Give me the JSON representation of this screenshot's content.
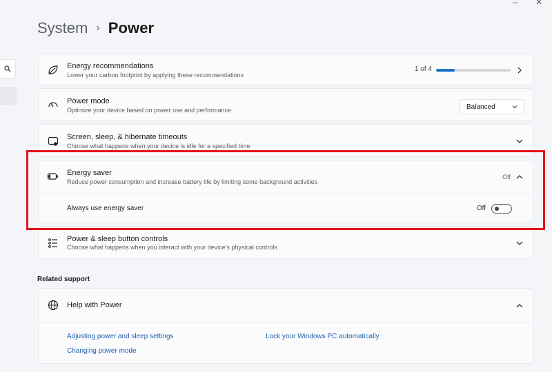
{
  "breadcrumb": {
    "parent": "System",
    "separator": "›",
    "current": "Power"
  },
  "settings": [
    {
      "title": "Energy recommendations",
      "subtitle": "Lower your carbon footprint by applying these recommendations",
      "progress_label": "1 of 4",
      "progress": 0.25
    },
    {
      "title": "Power mode",
      "subtitle": "Optimize your device based on power use and performance",
      "dropdown_value": "Balanced"
    },
    {
      "title": "Screen, sleep, & hibernate timeouts",
      "subtitle": "Choose what happens when your device is idle for a specified time"
    },
    {
      "title": "Energy saver",
      "subtitle": "Reduce power consumption and increase battery life by limiting some background activities",
      "status": "Off",
      "subsetting": {
        "label": "Always use energy saver",
        "state_label": "Off",
        "on": false
      }
    },
    {
      "title": "Power & sleep button controls",
      "subtitle": "Choose what happens when you interact with your device's physical controls"
    }
  ],
  "related_support": {
    "heading": "Related support",
    "card_title": "Help with Power",
    "links": [
      "Adjusting power and sleep settings",
      "Lock your Windows PC automatically",
      "Changing power mode"
    ]
  },
  "colors": {
    "accent": "#1e70c9",
    "highlight": "#e01418",
    "link": "#1f5fb0"
  },
  "icons": [
    "search-icon",
    "leaf-icon",
    "gauge-icon",
    "screen-sleep-icon",
    "battery-saver-icon",
    "button-controls-icon",
    "globe-icon",
    "chevron-right-icon",
    "chevron-down-icon",
    "chevron-up-icon"
  ]
}
